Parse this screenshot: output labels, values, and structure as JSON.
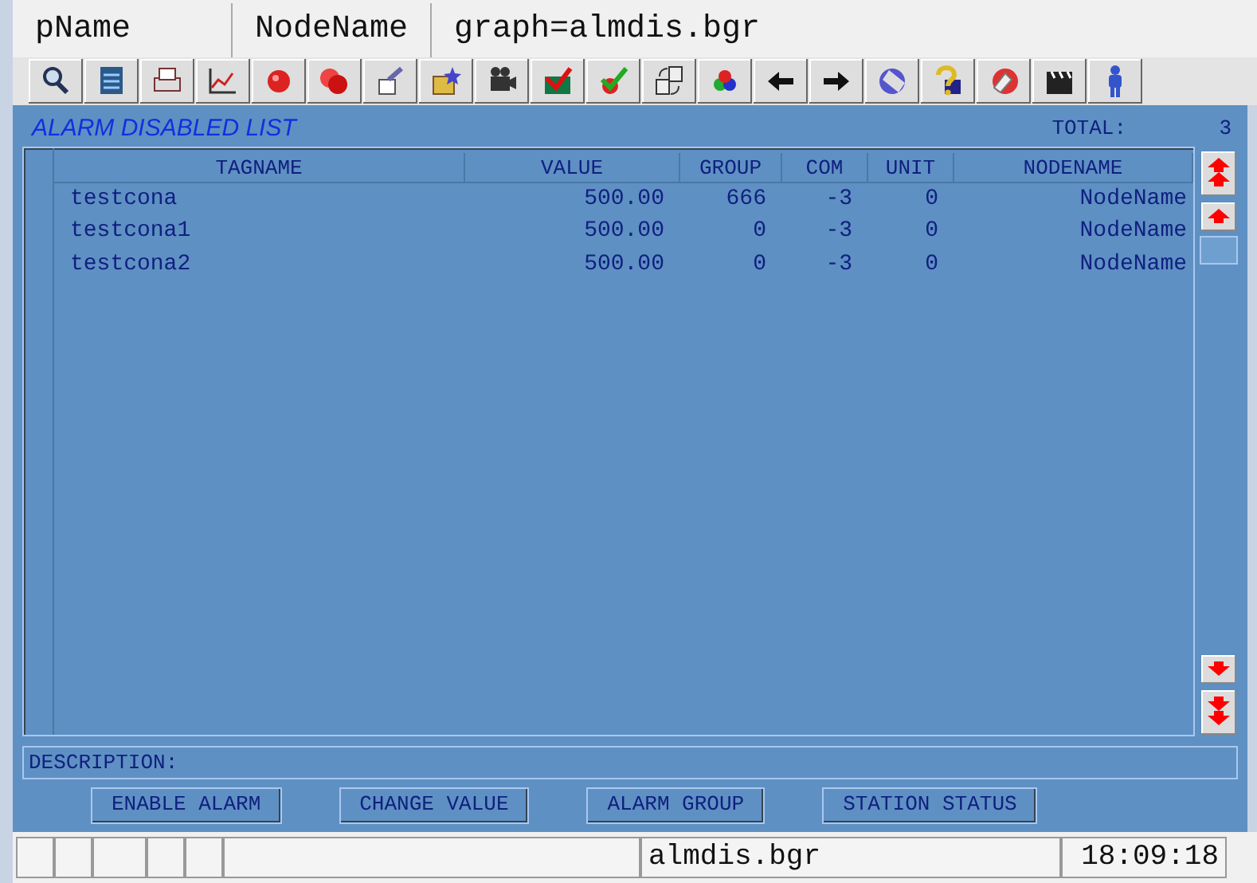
{
  "title_bar": {
    "cells": [
      "pName",
      "NodeName",
      "graph=almdis.bgr"
    ]
  },
  "panel": {
    "title": "ALARM DISABLED LIST",
    "total_label": "TOTAL:",
    "total_value": "3"
  },
  "table": {
    "columns": [
      "TAGNAME",
      "VALUE",
      "GROUP",
      "COM",
      "UNIT",
      "NODENAME"
    ],
    "rows": [
      {
        "cells": [
          "testcona",
          "500.00",
          "666",
          "-3",
          "0",
          "NodeName"
        ]
      },
      {
        "cells": [
          "testcona1",
          "500.00",
          "0",
          "-3",
          "0",
          "NodeName"
        ]
      },
      {
        "cells": [
          "testcona2",
          "500.00",
          "0",
          "-3",
          "0",
          "NodeName"
        ]
      }
    ]
  },
  "description": {
    "label": "DESCRIPTION:"
  },
  "buttons": [
    "ENABLE ALARM",
    "CHANGE VALUE",
    "ALARM GROUP",
    "STATION STATUS"
  ],
  "status_bar": {
    "file": "almdis.bgr",
    "time": "18:09:18"
  }
}
